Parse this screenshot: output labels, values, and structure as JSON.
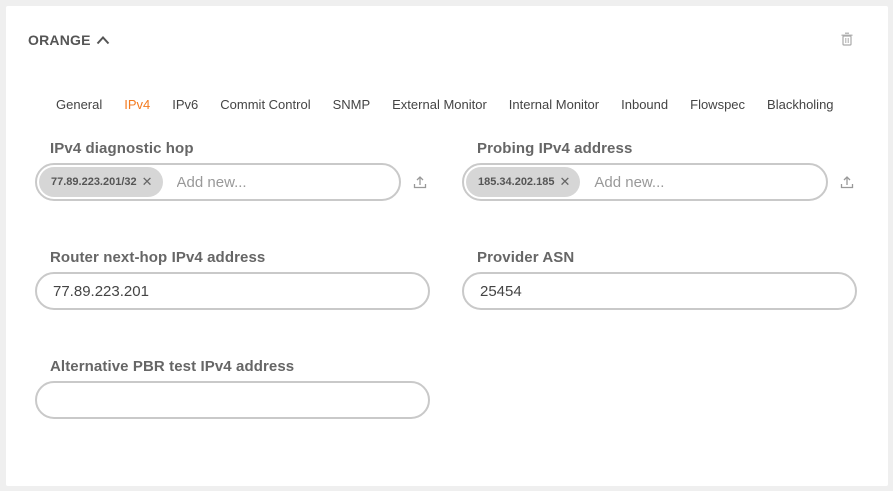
{
  "section": {
    "title": "ORANGE"
  },
  "tabs": [
    {
      "label": "General",
      "active": false
    },
    {
      "label": "IPv4",
      "active": true
    },
    {
      "label": "IPv6",
      "active": false
    },
    {
      "label": "Commit Control",
      "active": false
    },
    {
      "label": "SNMP",
      "active": false
    },
    {
      "label": "External Monitor",
      "active": false
    },
    {
      "label": "Internal Monitor",
      "active": false
    },
    {
      "label": "Inbound",
      "active": false
    },
    {
      "label": "Flowspec",
      "active": false
    },
    {
      "label": "Blackholing",
      "active": false
    }
  ],
  "fields": {
    "diagnostic_hop": {
      "label": "IPv4 diagnostic hop",
      "chip": "77.89.223.201/32",
      "placeholder": "Add new..."
    },
    "probing_address": {
      "label": "Probing IPv4 address",
      "chip": "185.34.202.185",
      "placeholder": "Add new..."
    },
    "router_next_hop": {
      "label": "Router next-hop IPv4 address",
      "value": "77.89.223.201"
    },
    "provider_asn": {
      "label": "Provider ASN",
      "value": "25454"
    },
    "alt_pbr": {
      "label": "Alternative PBR test IPv4 address",
      "value": ""
    }
  },
  "colors": {
    "accent": "#f47b20",
    "border": "#c9c9c9",
    "chip_bg": "#d6d6d6"
  },
  "icons": {
    "collapse": "chevron-up-icon",
    "delete": "trash-icon",
    "upload": "upload-icon",
    "remove_chip": "close-icon"
  }
}
